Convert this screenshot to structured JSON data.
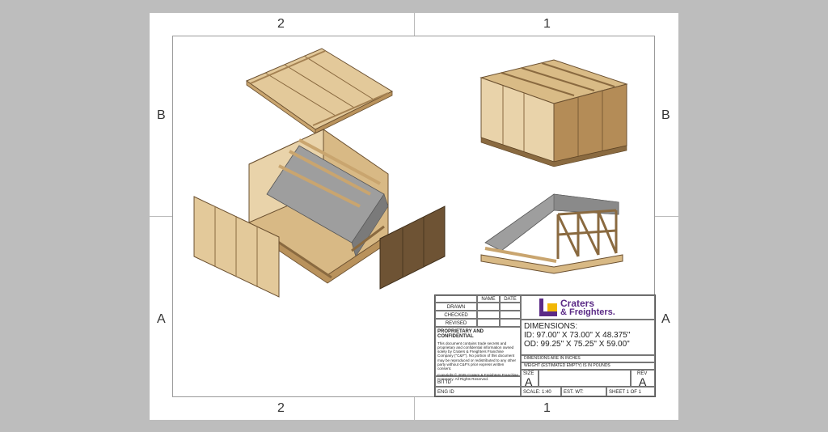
{
  "zones": {
    "top_left": "2",
    "top_right": "1",
    "bottom_left": "2",
    "bottom_right": "1",
    "left_upper": "B",
    "left_lower": "A",
    "right_upper": "B",
    "right_lower": "A"
  },
  "title_block": {
    "col_name": "NAME",
    "col_date": "DATE",
    "row_drawn": "DRAWN",
    "row_checked": "CHECKED",
    "row_revised": "REVISED",
    "proprietary_heading": "PROPRIETARY AND CONFIDENTIAL",
    "proprietary_text": "This document contains trade secrets and proprietary and confidential information owned solely by Craters & Freighters Franchise Company (\"C&F\"). No portion of this document may be reproduced or redistributed to any other party without C&F's prior express written consent.",
    "copyright": "Copyright © 2025 Craters & Freighters Franchise Company. All Rights Reserved.",
    "bit_id": "BIT ID",
    "eng_id": "ENG ID",
    "logo_line1": "Craters",
    "logo_line2": "& Freighters.",
    "dimensions_heading": "DIMENSIONS:",
    "id_dims": "ID: 97.00\" X 73.00\" X 48.375\"",
    "od_dims": "OD: 99.25\" X 75.25\" X 59.00\"",
    "note_inches": "DIMENSIONS ARE IN INCHES",
    "note_weight": "WEIGHT (ESTIMATED EMPTY) IS IN POUNDS",
    "size_label": "SIZE",
    "size_value": "A",
    "rev_label": "REV",
    "rev_value": "A",
    "scale": "SCALE: 1:40",
    "est_wt": "EST. WT:",
    "sheet": "SHEET 1 OF 1"
  },
  "colors": {
    "brand_purple": "#5b2a86",
    "brand_yellow": "#f2b705",
    "wood_light": "#e3c99a",
    "wood_mid": "#c9a56f",
    "wood_dark": "#7a5c35"
  }
}
